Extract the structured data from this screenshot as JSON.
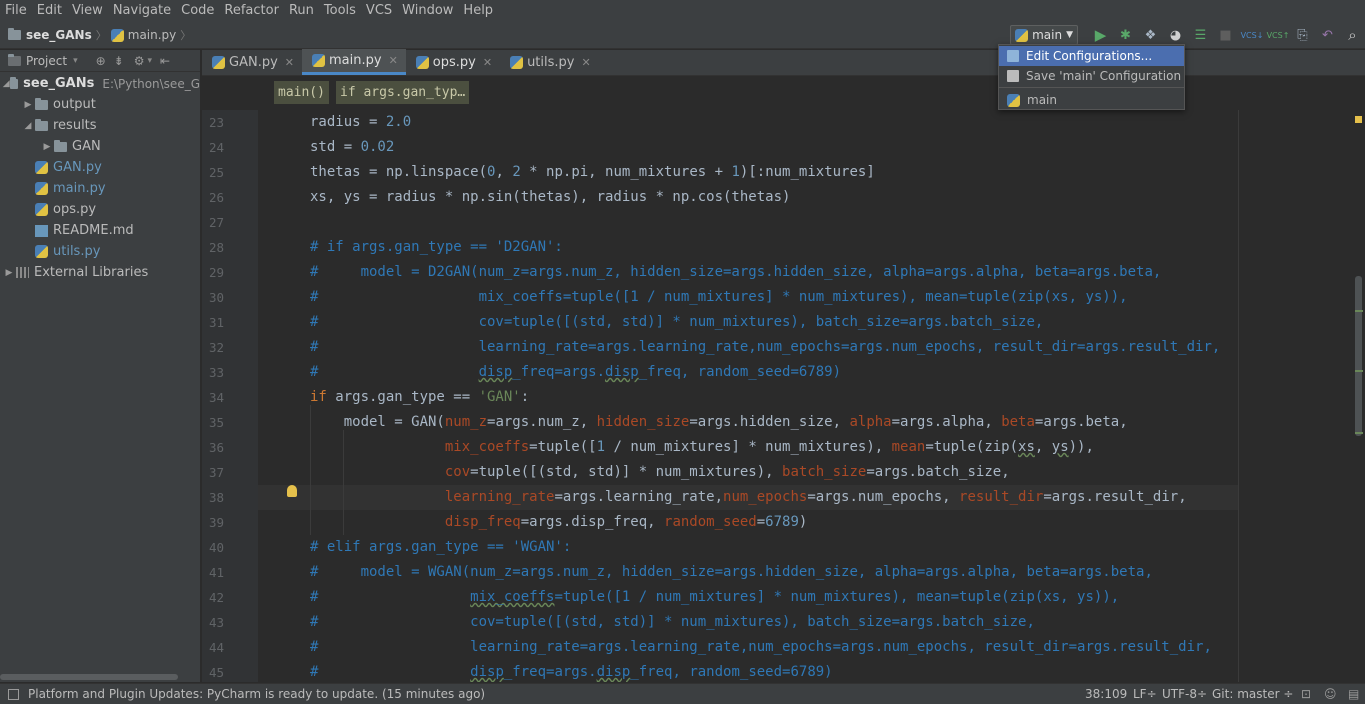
{
  "menu": [
    "File",
    "Edit",
    "View",
    "Navigate",
    "Code",
    "Refactor",
    "Run",
    "Tools",
    "VCS",
    "Window",
    "Help"
  ],
  "nav": {
    "project": "see_GANs",
    "file": "main.py"
  },
  "run_config": {
    "name": "main",
    "popup": {
      "edit": "Edit Configurations...",
      "save": "Save 'main' Configuration",
      "item": "main"
    }
  },
  "project_panel": {
    "title": "Project",
    "root": {
      "name": "see_GANs",
      "path": "E:\\Python\\see_G"
    },
    "items": [
      {
        "label": "output",
        "type": "folder",
        "level": 1,
        "arrow": "closed"
      },
      {
        "label": "results",
        "type": "folder",
        "level": 1,
        "arrow": "open"
      },
      {
        "label": "GAN",
        "type": "folder",
        "level": 2,
        "arrow": "closed"
      },
      {
        "label": "GAN.py",
        "type": "py",
        "level": 1,
        "arrow": "none"
      },
      {
        "label": "main.py",
        "type": "py",
        "level": 1,
        "arrow": "none"
      },
      {
        "label": "ops.py",
        "type": "py",
        "level": 1,
        "arrow": "none"
      },
      {
        "label": "README.md",
        "type": "md",
        "level": 1,
        "arrow": "none"
      },
      {
        "label": "utils.py",
        "type": "py",
        "level": 1,
        "arrow": "none"
      },
      {
        "label": "External Libraries",
        "type": "lib",
        "level": 0,
        "arrow": "closed"
      }
    ]
  },
  "tabs": [
    {
      "label": "GAN.py",
      "active": false
    },
    {
      "label": "main.py",
      "active": true
    },
    {
      "label": "ops.py",
      "active": false
    },
    {
      "label": "utils.py",
      "active": false
    }
  ],
  "code_crumbs": [
    "main()",
    "if args.gan_typ…"
  ],
  "line_numbers": [
    "23",
    "24",
    "25",
    "26",
    "27",
    "28",
    "29",
    "30",
    "31",
    "32",
    "33",
    "34",
    "35",
    "36",
    "37",
    "38",
    "39",
    "40",
    "41",
    "42",
    "43",
    "44",
    "45"
  ],
  "status": {
    "message": "Platform and Plugin Updates: PyCharm is ready to update. (15 minutes ago)",
    "position": "38:109",
    "line_sep": "LF÷",
    "encoding": "UTF-8÷",
    "git": "Git: master ÷"
  },
  "colors": {
    "comment": "#2f78b6",
    "keyword": "#cc7832",
    "string": "#6a8759",
    "number": "#6897bb",
    "selection": "#4b6eaf"
  }
}
